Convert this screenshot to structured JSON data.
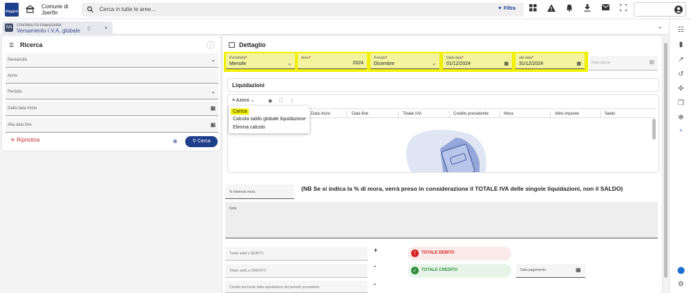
{
  "header": {
    "logo_text": "Maggioli",
    "comune_line1": "Comune di",
    "comune_line2": "Jserfin",
    "search_placeholder": "Cerca in tutte le aree...",
    "filter_label": "Filtra"
  },
  "tab": {
    "badge": "IVA",
    "category": "CONTABILITÀ FINANZIARIA",
    "title": "Versamento I.V.A. globale"
  },
  "ricerca": {
    "title": "Ricerca",
    "fields": [
      "Periodicità",
      "Anno",
      "Periodo",
      "Dalla data inizio",
      "Alla data fine"
    ],
    "reset_label": "Ripristina",
    "search_label": "Cerca"
  },
  "dettaglio": {
    "title": "Dettaglio",
    "periodicita": {
      "label": "Periodicità",
      "value": "Mensile"
    },
    "anno": {
      "label": "Anno",
      "value": "2024"
    },
    "periodo": {
      "label": "Periodo",
      "value": "Dicembre"
    },
    "dalla_data": {
      "label": "Dalla data",
      "value": "01/12/2024"
    },
    "alla_data": {
      "label": "alla data",
      "value": "31/12/2024"
    },
    "data_calcolo_label": "Data calcolo",
    "liquidazioni_title": "Liquidazioni",
    "azioni_label": "Azioni",
    "columns": [
      "Data inizio",
      "Data fine",
      "Totale IVA",
      "Credito precedente",
      "Mora",
      "Altre imposte",
      "Saldo"
    ],
    "menu_items": [
      "Carica",
      "Calcola saldo globale liquidazione",
      "Elimina calcolo"
    ],
    "interessi_label": "% interessi mora",
    "nb_text": "(NB Se si indica la % di mora, verrà preso in considerazione il TOTALE IVA delle singole liquidazioni, non il SALDO)",
    "note_label": "Note",
    "totale_debito_label": "Totale saldi a DEBITO",
    "totale_credito_label": "Totale saldi a CREDITO",
    "credito_precedente_label": "Credito derivante dalla liquidazione del periodo precedente",
    "sign_plus": "+",
    "sign_minus": "-",
    "badge_debito": "TOTALE DEBITO",
    "badge_credito": "TOTALE CREDITO",
    "data_pagamento_label": "Data pagamento",
    "colors": {
      "debito": "#d32020",
      "credito": "#2e8b3d",
      "highlight": "#f0f000",
      "primary": "#1f3f8b"
    }
  }
}
